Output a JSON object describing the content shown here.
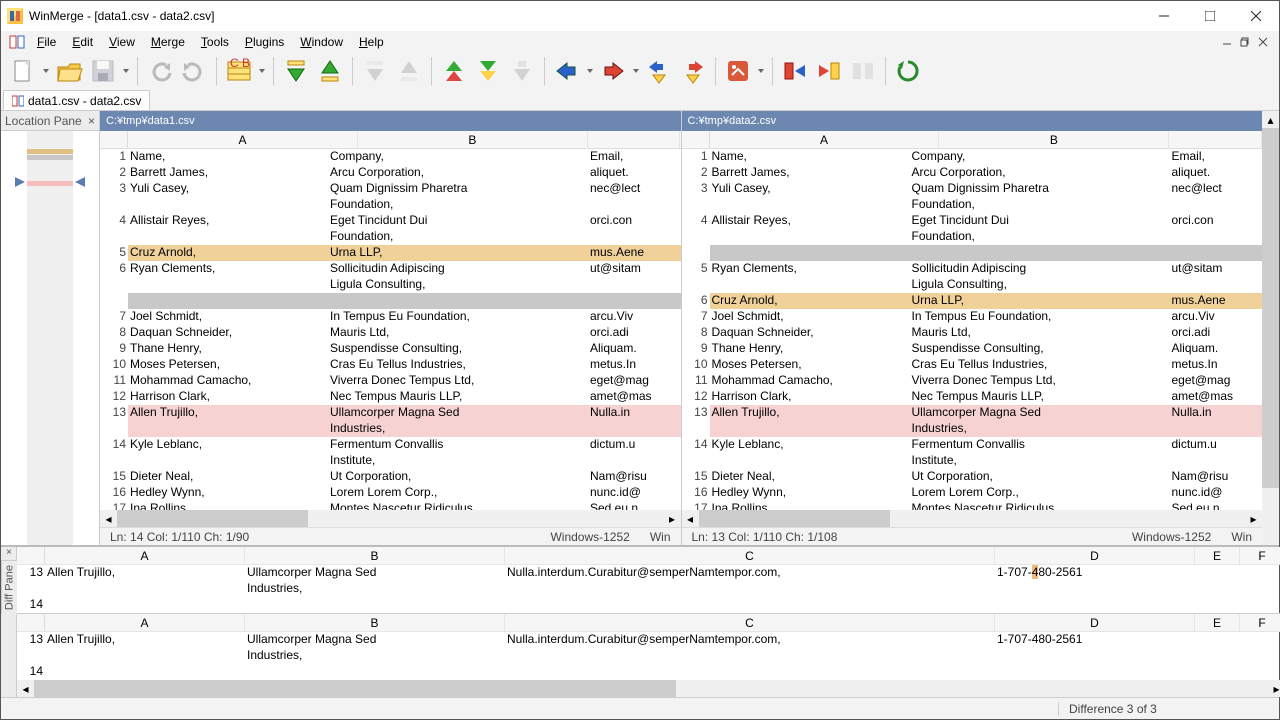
{
  "window": {
    "title": "WinMerge - [data1.csv - data2.csv]"
  },
  "menu": [
    "File",
    "Edit",
    "View",
    "Merge",
    "Tools",
    "Plugins",
    "Window",
    "Help"
  ],
  "doctab": "data1.csv - data2.csv",
  "locpane": {
    "title": "Location Pane"
  },
  "left": {
    "path": "C:¥tmp¥data1.csv",
    "cols": [
      "A",
      "B"
    ],
    "status": {
      "pos": "Ln: 14  Col: 1/110  Ch: 1/90",
      "enc": "Windows-1252",
      "eol": "Win"
    },
    "rows": [
      {
        "n": "1",
        "a": "Name,",
        "b": "Company,",
        "c": "Email,"
      },
      {
        "n": "2",
        "a": "Barrett James,",
        "b": "Arcu Corporation,",
        "c": "aliquet."
      },
      {
        "n": "3",
        "a": "Yuli Casey,",
        "b": "Quam Dignissim Pharetra Foundation,",
        "c": "nec@lect"
      },
      {
        "n": "4",
        "a": "Allistair Reyes,",
        "b": "Eget Tincidunt Dui Foundation,",
        "c": "orci.con"
      },
      {
        "n": "5",
        "a": "Cruz Arnold,",
        "b": "Urna LLP,",
        "c": "mus.Aene",
        "cls": "diff-moved"
      },
      {
        "n": "6",
        "a": "Ryan Clements,",
        "b": "Sollicitudin Adipiscing Ligula Consulting,",
        "c": "ut@sitam"
      },
      {
        "n": "",
        "a": "",
        "b": "",
        "c": "",
        "cls": "diff-gap"
      },
      {
        "n": "7",
        "a": "Joel Schmidt,",
        "b": "In Tempus Eu Foundation,",
        "c": "arcu.Viv"
      },
      {
        "n": "8",
        "a": "Daquan Schneider,",
        "b": "Mauris Ltd,",
        "c": "orci.adi"
      },
      {
        "n": "9",
        "a": "Thane Henry,",
        "b": "Suspendisse Consulting,",
        "c": "Aliquam."
      },
      {
        "n": "10",
        "a": "Moses Petersen,",
        "b": "Cras Eu Tellus Industries,",
        "c": "metus.In"
      },
      {
        "n": "11",
        "a": "Mohammad Camacho,",
        "b": "Viverra Donec Tempus Ltd,",
        "c": "eget@mag"
      },
      {
        "n": "12",
        "a": "Harrison Clark,",
        "b": "Nec Tempus Mauris LLP,",
        "c": "amet@mas"
      },
      {
        "n": "13",
        "a": "Allen Trujillo,",
        "b": "Ullamcorper Magna Sed Industries,",
        "c": "Nulla.in",
        "cls": "diff-changed"
      },
      {
        "n": "14",
        "a": "Kyle Leblanc,",
        "b": "Fermentum Convallis Institute,",
        "c": "dictum.u"
      },
      {
        "n": "15",
        "a": "Dieter Neal,",
        "b": "Ut Corporation,",
        "c": "Nam@risu"
      },
      {
        "n": "16",
        "a": "Hedley Wynn,",
        "b": "Lorem Lorem Corp.,",
        "c": "nunc.id@"
      },
      {
        "n": "17",
        "a": "Ina Rollins,",
        "b": "Montes Nascetur Ridiculus",
        "c": "Sed eu n"
      }
    ]
  },
  "right": {
    "path": "C:¥tmp¥data2.csv",
    "cols": [
      "A",
      "B"
    ],
    "status": {
      "pos": "Ln: 13  Col: 1/110  Ch: 1/108",
      "enc": "Windows-1252",
      "eol": "Win"
    },
    "rows": [
      {
        "n": "1",
        "a": "Name,",
        "b": "Company,",
        "c": "Email,"
      },
      {
        "n": "2",
        "a": "Barrett James,",
        "b": "Arcu Corporation,",
        "c": "aliquet."
      },
      {
        "n": "3",
        "a": "Yuli Casey,",
        "b": "Quam Dignissim Pharetra Foundation,",
        "c": "nec@lect"
      },
      {
        "n": "4",
        "a": "Allistair Reyes,",
        "b": "Eget Tincidunt Dui Foundation,",
        "c": "orci.con"
      },
      {
        "n": "",
        "a": "",
        "b": "",
        "c": "",
        "cls": "diff-gap"
      },
      {
        "n": "5",
        "a": "Ryan Clements,",
        "b": "Sollicitudin Adipiscing Ligula Consulting,",
        "c": "ut@sitam"
      },
      {
        "n": "6",
        "a": "Cruz Arnold,",
        "b": "Urna LLP,",
        "c": "mus.Aene",
        "cls": "diff-moved"
      },
      {
        "n": "7",
        "a": "Joel Schmidt,",
        "b": "In Tempus Eu Foundation,",
        "c": "arcu.Viv"
      },
      {
        "n": "8",
        "a": "Daquan Schneider,",
        "b": "Mauris Ltd,",
        "c": "orci.adi"
      },
      {
        "n": "9",
        "a": "Thane Henry,",
        "b": "Suspendisse Consulting,",
        "c": "Aliquam."
      },
      {
        "n": "10",
        "a": "Moses Petersen,",
        "b": "Cras Eu Tellus Industries,",
        "c": "metus.In"
      },
      {
        "n": "11",
        "a": "Mohammad Camacho,",
        "b": "Viverra Donec Tempus Ltd,",
        "c": "eget@mag"
      },
      {
        "n": "12",
        "a": "Harrison Clark,",
        "b": "Nec Tempus Mauris LLP,",
        "c": "amet@mas"
      },
      {
        "n": "13",
        "a": "Allen Trujillo,",
        "b": "Ullamcorper Magna Sed Industries,",
        "c": "Nulla.in",
        "cls": "diff-changed"
      },
      {
        "n": "14",
        "a": "Kyle Leblanc,",
        "b": "Fermentum Convallis Institute,",
        "c": "dictum.u"
      },
      {
        "n": "15",
        "a": "Dieter Neal,",
        "b": "Ut Corporation,",
        "c": "Nam@risu"
      },
      {
        "n": "16",
        "a": "Hedley Wynn,",
        "b": "Lorem Lorem Corp.,",
        "c": "nunc.id@"
      },
      {
        "n": "17",
        "a": "Ina Rollins,",
        "b": "Montes Nascetur Ridiculus",
        "c": "Sed eu n"
      }
    ]
  },
  "diffpane": {
    "label": "Diff Pane",
    "cols": [
      "A",
      "B",
      "C",
      "D",
      "E",
      "F"
    ],
    "top": {
      "n": "13",
      "a": "Allen Trujillo,",
      "b": "Ullamcorper Magna Sed Industries,",
      "c": "Nulla.interdum.Curabitur@semperNamtempor.com,",
      "d_pre": "1-707-",
      "d_diff": "4",
      "d_post": "80-2561"
    },
    "bot": {
      "n": "13",
      "a": "Allen Trujillo,",
      "b": "Ullamcorper Magna Sed Industries,",
      "c": "Nulla.interdum.Curabitur@semperNamtempor.com,",
      "d": "1-707-480-2561"
    },
    "next": "14"
  },
  "statusbar": {
    "diff": "Difference 3 of 3"
  }
}
